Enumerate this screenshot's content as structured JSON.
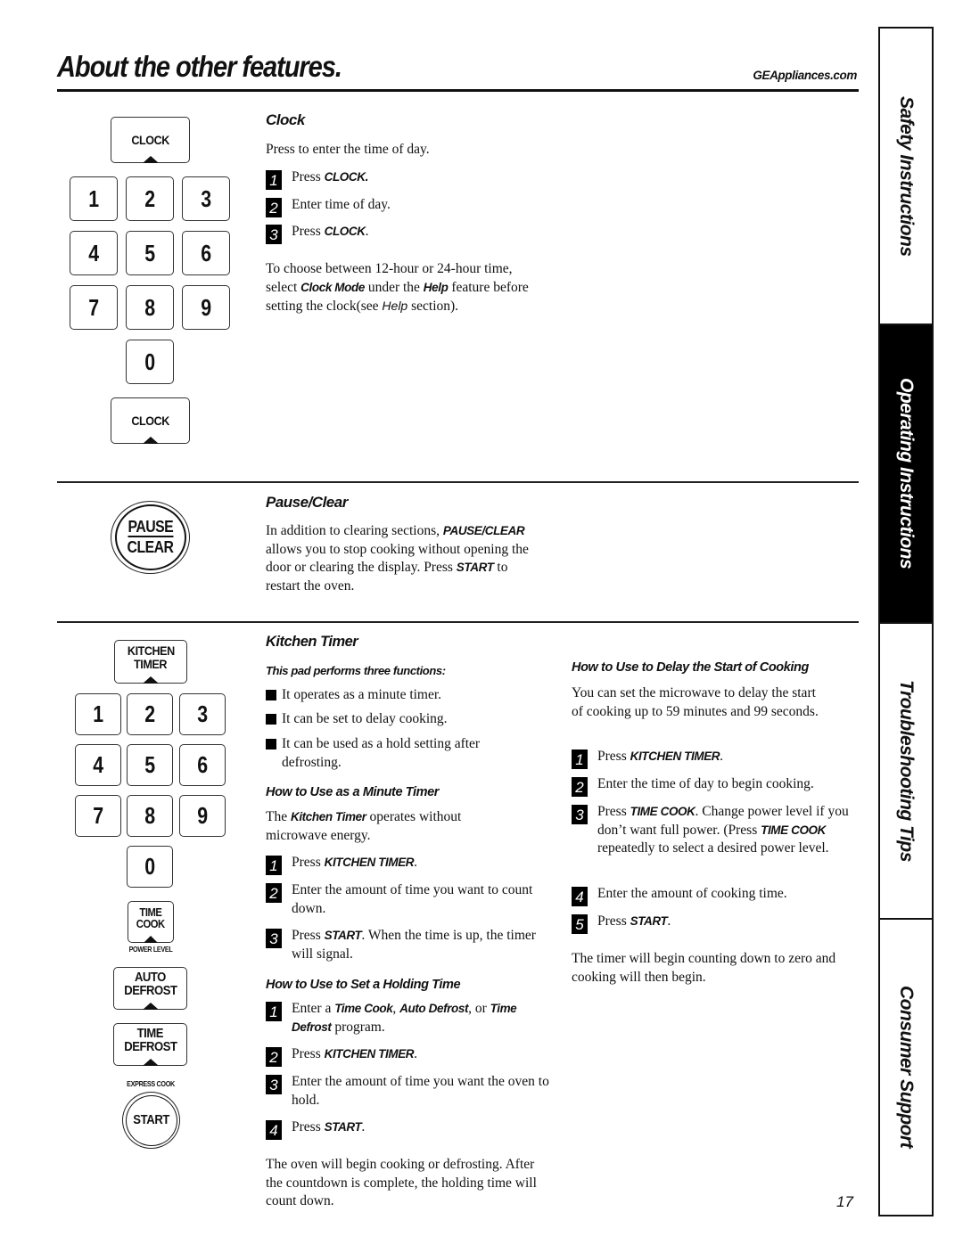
{
  "header": {
    "title": "About the other features.",
    "site": "GEAppliances.com"
  },
  "side_tabs": [
    {
      "label": "Safety Instructions",
      "active": false
    },
    {
      "label": "Operating Instructions",
      "active": true
    },
    {
      "label": "Troubleshooting Tips",
      "active": false
    },
    {
      "label": "Consumer Support",
      "active": false
    }
  ],
  "clock": {
    "heading": "Clock",
    "intro": "Press to enter the time of day.",
    "keypad": {
      "top_key": "CLOCK",
      "digits": [
        "1",
        "2",
        "3",
        "4",
        "5",
        "6",
        "7",
        "8",
        "9",
        "0"
      ],
      "bottom_key": "CLOCK"
    },
    "steps": [
      {
        "n": "1",
        "pre": "Press ",
        "bold": "CLOCK.",
        "post": ""
      },
      {
        "n": "2",
        "pre": "Enter time of day.",
        "bold": "",
        "post": ""
      },
      {
        "n": "3",
        "pre": "Press ",
        "bold": "CLOCK",
        "post": "."
      }
    ],
    "note": {
      "p1": "To choose between 12-hour or 24-hour time, select ",
      "b1": "Clock Mode",
      "p2": " under the ",
      "b2": "Help",
      "p3": " feature before setting the clock(see ",
      "i1": "Help",
      "p4": " section)."
    }
  },
  "pause_clear": {
    "heading": "Pause/Clear",
    "button_top": "PAUSE",
    "button_bottom": "CLEAR",
    "p1": "In addition to clearing sections, ",
    "b1": "PAUSE/CLEAR",
    "p2": " allows you to stop cooking without opening the door or clearing the display. Press ",
    "b2": "START",
    "p3": " to restart the oven."
  },
  "kitchen_timer": {
    "heading": "Kitchen Timer",
    "keypad": {
      "top_key_line1": "KITCHEN",
      "top_key_line2": "TIMER",
      "digits": [
        "1",
        "2",
        "3",
        "4",
        "5",
        "6",
        "7",
        "8",
        "9",
        "0"
      ],
      "time_cook_line1": "TIME",
      "time_cook_line2": "COOK",
      "power_level": "POWER LEVEL",
      "auto_defrost_line1": "AUTO",
      "auto_defrost_line2": "DEFROST",
      "time_defrost_line1": "TIME",
      "time_defrost_line2": "DEFROST",
      "express_cook": "EXPRESS COOK",
      "start": "START"
    },
    "functions_heading": "This pad performs three functions:",
    "functions": [
      "It operates as a minute timer.",
      "It can be set to delay cooking.",
      "It can be used as a hold setting after defrosting."
    ],
    "minute_timer": {
      "heading": "How to Use as a Minute Timer",
      "intro_pre": "The ",
      "intro_bold": "Kitchen Timer",
      "intro_post": " operates without microwave energy.",
      "steps": [
        {
          "n": "1",
          "pre": "Press ",
          "bold": "KITCHEN TIMER",
          "post": "."
        },
        {
          "n": "2",
          "pre": "Enter the amount of time you want to count down.",
          "bold": "",
          "post": ""
        },
        {
          "n": "3",
          "pre": "Press ",
          "bold": "START",
          "post": ". When the time is up, the timer will signal."
        }
      ]
    },
    "holding_time": {
      "heading": "How to Use to Set a Holding Time",
      "step1": {
        "n": "1",
        "p1": "Enter a ",
        "b1": "Time Cook",
        "p2": ", ",
        "b2": "Auto Defrost",
        "p3": ", or ",
        "b3": "Time Defrost",
        "p4": " program."
      },
      "steps": [
        {
          "n": "2",
          "pre": "Press ",
          "bold": "KITCHEN TIMER",
          "post": "."
        },
        {
          "n": "3",
          "pre": "Enter the amount of time you want the oven to hold.",
          "bold": "",
          "post": ""
        },
        {
          "n": "4",
          "pre": "Press ",
          "bold": "START",
          "post": "."
        }
      ],
      "outro": "The oven will begin cooking or defrosting. After the countdown is complete, the holding time will count down."
    },
    "delay_start": {
      "heading": "How to Use to Delay the Start of Cooking",
      "intro": "You can set the microwave to delay the start of cooking up to 59 minutes and 99 seconds.",
      "steps": [
        {
          "n": "1",
          "pre": "Press ",
          "bold": "KITCHEN TIMER",
          "post": "."
        },
        {
          "n": "2",
          "pre": "Enter the time of day to begin cooking.",
          "bold": "",
          "post": ""
        }
      ],
      "step3": {
        "n": "3",
        "p1": "Press ",
        "b1": "TIME COOK",
        "p2": ". Change power level if you don’t want full power. (Press ",
        "b2": "TIME COOK",
        "p3": " repeatedly to select a desired power level."
      },
      "steps_after": [
        {
          "n": "4",
          "pre": "Enter the amount of cooking time.",
          "bold": "",
          "post": ""
        },
        {
          "n": "5",
          "pre": "Press ",
          "bold": "START",
          "post": "."
        }
      ],
      "outro": "The timer will begin counting down to zero and cooking will then begin."
    }
  },
  "page_number": "17"
}
